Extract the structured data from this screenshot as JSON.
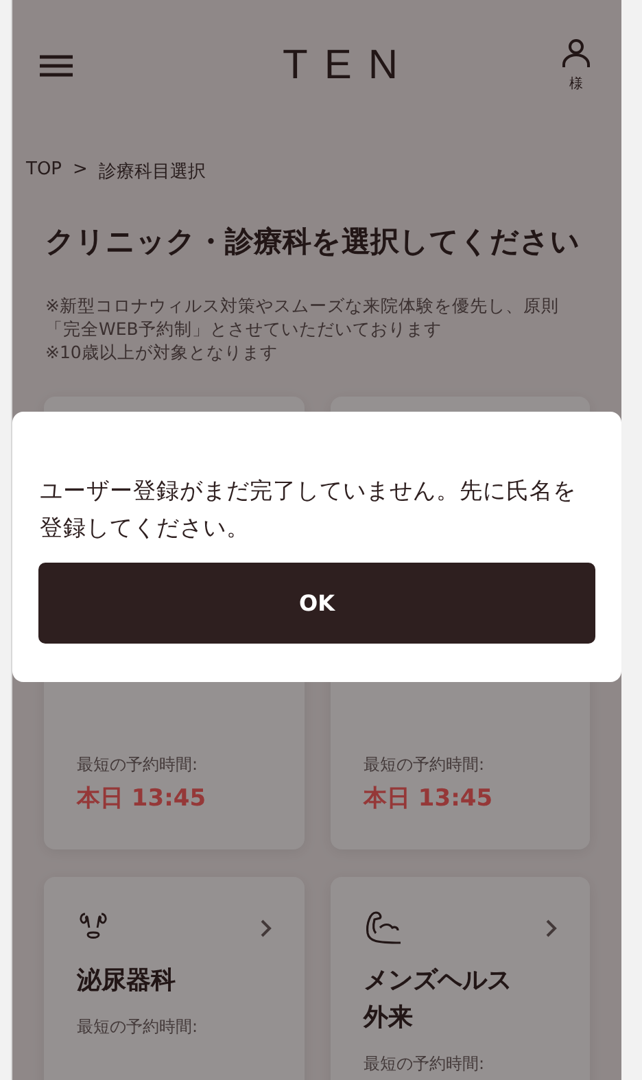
{
  "header": {
    "logo": "TEN",
    "user_label": "様"
  },
  "breadcrumb": {
    "items": [
      "TOP",
      "診療科目選択"
    ],
    "separator": ">"
  },
  "title": "クリニック・診療科を選択してください",
  "notes": [
    "※新型コロナウィルス対策やスムーズな来院体験を優先し、原則「完全WEB予約制」とさせていただいております",
    "※10歳以上が対象となります"
  ],
  "cards": [
    {
      "kind": "covered",
      "earliest_label": "最短の予約時間:",
      "earliest_time": "本日 13:45"
    },
    {
      "kind": "covered",
      "earliest_label": "最短の予約時間:",
      "earliest_time": "本日 13:45"
    },
    {
      "kind": "urology",
      "name": "泌尿器科",
      "earliest_label": "最短の予約時間:"
    },
    {
      "kind": "menshealth",
      "name": "メンズヘルス外来",
      "earliest_label": "最短の予約時間:"
    }
  ],
  "dialog": {
    "message": "ユーザー登録がまだ完了していません。先に氏名を登録してください。",
    "button": "OK"
  }
}
